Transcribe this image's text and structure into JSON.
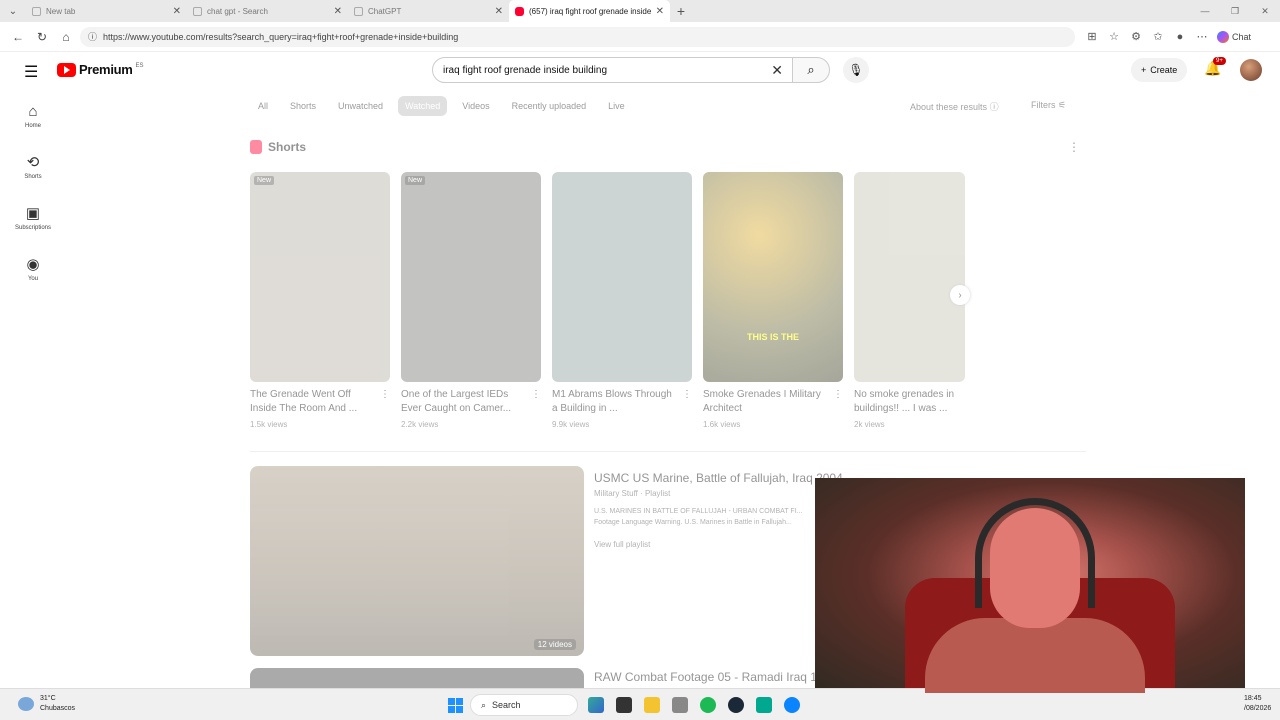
{
  "browser": {
    "tabs": [
      {
        "label": "New tab",
        "active": false
      },
      {
        "label": "chat gpt - Search",
        "active": false
      },
      {
        "label": "ChatGPT",
        "active": false
      },
      {
        "label": "(657) iraq fight roof grenade inside",
        "active": true
      }
    ],
    "url": "https://www.youtube.com/results?search_query=iraq+fight+roof+grenade+inside+building",
    "copilot_label": "Chat"
  },
  "youtube": {
    "logo_text": "Premium",
    "logo_country": "ES",
    "search_value": "iraq fight roof grenade inside building",
    "create_label": "Create",
    "notification_count": "9+",
    "nav": [
      {
        "label": "Home",
        "icon": "home-icon"
      },
      {
        "label": "Shorts",
        "icon": "shorts-icon"
      },
      {
        "label": "Subscriptions",
        "icon": "subscriptions-icon"
      },
      {
        "label": "You",
        "icon": "you-icon"
      }
    ],
    "chips": [
      "All",
      "Shorts",
      "Unwatched",
      "Watched",
      "Videos",
      "Recently uploaded",
      "Live"
    ],
    "hover_chip": "Watched",
    "about_label": "About these results",
    "filters_label": "Filters",
    "shorts_heading": "Shorts",
    "shorts": [
      {
        "title": "The Grenade Went Off Inside The Room And ...",
        "views": "1.5k views",
        "tag": "New",
        "overlay": "",
        "color": "#b8b2a6"
      },
      {
        "title": "One of the Largest IEDs Ever Caught on Camer...",
        "views": "2.2k views",
        "tag": "New",
        "overlay": "",
        "color": "#7b7e78"
      },
      {
        "title": "M1 Abrams Blows Through a Building in ...",
        "views": "9.9k views",
        "tag": "",
        "overlay": "",
        "color": "#8fa4a0"
      },
      {
        "title": "Smoke Grenades I Military Architect",
        "views": "1.6k views",
        "tag": "",
        "overlay": "THIS IS THE",
        "color": "#6b6a3c"
      },
      {
        "title": "No smoke grenades in buildings!! ... I was ...",
        "views": "2k views",
        "tag": "",
        "overlay": "",
        "color": "#c9c7b6"
      }
    ],
    "playlist": {
      "title": "USMC US Marine, Battle of Fallujah, Iraq 2004",
      "channel": "Military Stuff · Playlist",
      "description": "U.S. MARINES IN BATTLE OF FALLUJAH - URBAN COMBAT FI... Footage Language Warning. U.S. Marines in Battle in Fallujah...",
      "view_link": "View full playlist",
      "count": "12 videos"
    },
    "playlist2_title": "RAW Combat Footage 05 - Ramadi Iraq 1"
  },
  "taskbar": {
    "temperature": "31°C",
    "weather": "Chubascos",
    "search_label": "Search",
    "time": "18:45",
    "date": "/08/2026"
  }
}
